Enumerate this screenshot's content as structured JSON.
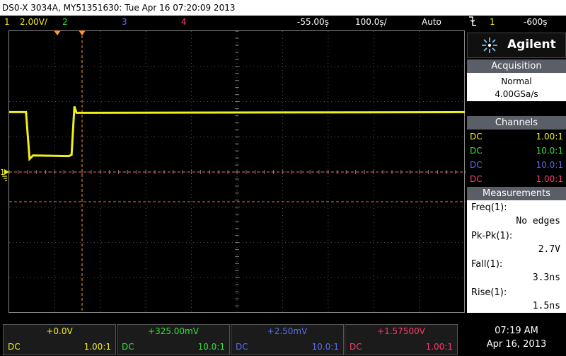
{
  "title": "DS0-X 3034A, MY51351630: Tue Apr 16 07:20:09 2013",
  "topbar": {
    "ch1": "1",
    "ch1_scale": "2.00V/",
    "ch2": "2",
    "ch3": "3",
    "ch4": "4",
    "time_delay": "-55.00ș",
    "time_scale": "100.0ș/",
    "trigger_mode": "Auto",
    "trigger_icon": "trigger-edge-falling-icon",
    "trigger_source": "1",
    "trigger_level": "-600ș"
  },
  "colors": {
    "ch1": "#f2ee18",
    "ch2": "#34e03a",
    "ch3": "#5a6df0",
    "ch4": "#ff3a6a",
    "accent_orange": "#ff9a2a",
    "panel_header": "#5a5e66"
  },
  "brand": {
    "name": "Agilent",
    "logo_icon": "agilent-spark-icon"
  },
  "acquisition": {
    "header": "Acquisition",
    "mode": "Normal",
    "rate": "4.00GSa/s"
  },
  "channels": {
    "header": "Channels",
    "rows": [
      {
        "coupling": "DC",
        "probe": "1.00:1"
      },
      {
        "coupling": "DC",
        "probe": "10.0:1"
      },
      {
        "coupling": "DC",
        "probe": "10.0:1"
      },
      {
        "coupling": "DC",
        "probe": "1.00:1"
      }
    ]
  },
  "measurements": {
    "header": "Measurements",
    "items": [
      {
        "name": "Freq(1):",
        "value": "No edges"
      },
      {
        "name": "Pk-Pk(1):",
        "value": "2.7V"
      },
      {
        "name": "Fall(1):",
        "value": "3.3ns"
      },
      {
        "name": "Rise(1):",
        "value": "1.5ns"
      }
    ]
  },
  "bottom": {
    "channels": [
      {
        "offset": "+0.0V",
        "coupling": "DC",
        "probe": "1.00:1"
      },
      {
        "offset": "+325.00mV",
        "coupling": "DC",
        "probe": "10.0:1"
      },
      {
        "offset": "+2.50mV",
        "coupling": "DC",
        "probe": "10.0:1"
      },
      {
        "offset": "+1.57500V",
        "coupling": "DC",
        "probe": "1.00:1"
      }
    ],
    "time": "07:19 AM",
    "date": "Apr 16, 2013"
  },
  "waveform": {
    "channel": "1",
    "high_level_div": 2.3,
    "low_level_div": 3.55,
    "fall_time_div": 0.4,
    "rise_time_div": 1.4
  }
}
